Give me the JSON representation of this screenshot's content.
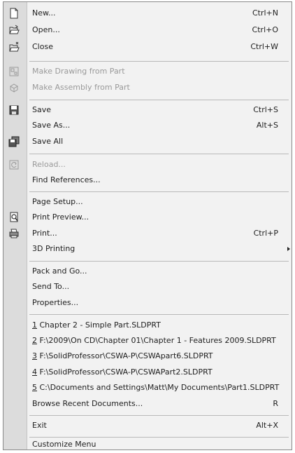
{
  "menu": {
    "new": {
      "label": "New...",
      "shortcut": "Ctrl+N"
    },
    "open": {
      "label": "Open...",
      "shortcut": "Ctrl+O"
    },
    "close": {
      "label": "Close",
      "shortcut": "Ctrl+W"
    },
    "make_drawing": {
      "label": "Make Drawing from Part"
    },
    "make_assembly": {
      "label": "Make Assembly from Part"
    },
    "save": {
      "label": "Save",
      "shortcut": "Ctrl+S"
    },
    "save_as": {
      "label": "Save As...",
      "shortcut": "Alt+S"
    },
    "save_all": {
      "label": "Save All"
    },
    "reload": {
      "label": "Reload..."
    },
    "find_references": {
      "label": "Find References..."
    },
    "page_setup": {
      "label": "Page Setup..."
    },
    "print_preview": {
      "label": "Print Preview..."
    },
    "print": {
      "label": "Print...",
      "shortcut": "Ctrl+P"
    },
    "printing_3d": {
      "label": "3D Printing"
    },
    "pack_and_go": {
      "label": "Pack and Go..."
    },
    "send_to": {
      "label": "Send To..."
    },
    "properties": {
      "label": "Properties..."
    },
    "recent": [
      {
        "num": "1",
        "label": " Chapter 2 - Simple Part.SLDPRT"
      },
      {
        "num": "2",
        "label": " F:\\2009\\On CD\\Chapter 01\\Chapter 1 - Features 2009.SLDPRT"
      },
      {
        "num": "3",
        "label": " F:\\SolidProfessor\\CSWA-P\\CSWApart6.SLDPRT"
      },
      {
        "num": "4",
        "label": " F:\\SolidProfessor\\CSWA-P\\CSWAPart2.SLDPRT"
      },
      {
        "num": "5",
        "label": " C:\\Documents and Settings\\Matt\\My Documents\\Part1.SLDPRT"
      }
    ],
    "browse_recent": {
      "label": "Browse Recent Documents...",
      "shortcut": "R"
    },
    "exit": {
      "label": "Exit",
      "shortcut": "Alt+X"
    },
    "customize": {
      "label": "Customize Menu"
    }
  }
}
